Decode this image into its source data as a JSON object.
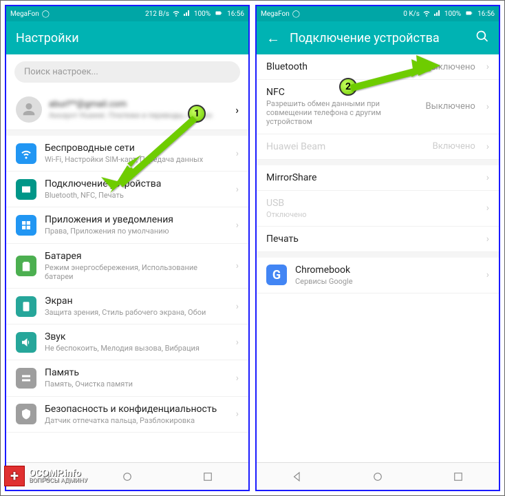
{
  "statusbar": {
    "carrier": "MegaFon",
    "speed_left": "212 B/s",
    "speed_right": "0 K/s",
    "battery": "100%",
    "time": "16:56"
  },
  "left": {
    "title": "Настройки",
    "search_placeholder": "Поиск настроек...",
    "profile": {
      "line1": "aburl**@gmail.com",
      "line2": "Аккаунт Huawei. Платежи и переводы, облако"
    },
    "items": [
      {
        "icon": "wifi",
        "color": "ic-blue",
        "title": "Беспроводные сети",
        "sub": "Wi-Fi, Настройки SIM-карт, Передача данных"
      },
      {
        "icon": "device",
        "color": "ic-teal",
        "title": "Подключение устройства",
        "sub": "Bluetooth, NFC, Печать"
      },
      {
        "icon": "apps",
        "color": "ic-blue",
        "title": "Приложения и уведомления",
        "sub": "Права, Приложения по умолчанию"
      },
      {
        "icon": "battery",
        "color": "ic-green",
        "title": "Батарея",
        "sub": "Режим энергосбережения, Использование батареи"
      },
      {
        "icon": "display",
        "color": "ic-tealg",
        "title": "Экран",
        "sub": "Защита зрения, Стиль рабочего экрана, Обои"
      },
      {
        "icon": "sound",
        "color": "ic-tealg",
        "title": "Звук",
        "sub": "Не беспокоить, Мелодия вызова, Вибрация"
      },
      {
        "icon": "storage",
        "color": "ic-grey",
        "title": "Память",
        "sub": "Память, Очистка памяти"
      },
      {
        "icon": "security",
        "color": "ic-grey",
        "title": "Безопасность и конфиденциальность",
        "sub": "Датчик отпечатка пальца, Разблокировка"
      }
    ]
  },
  "right": {
    "title": "Подключение устройства",
    "items": [
      {
        "title": "Bluetooth",
        "value": "Выключено"
      },
      {
        "title": "NFC",
        "sub": "Разрешить обмен данными при совмещении телефона с другим устройством",
        "value": "Выключено"
      },
      {
        "title": "Huawei Beam",
        "value": "Включено",
        "disabled": true
      },
      {
        "title": "MirrorShare"
      },
      {
        "title": "USB",
        "sub": "Отключено",
        "disabled": true
      },
      {
        "title": "Печать"
      },
      {
        "icon": "google",
        "title": "Chromebook",
        "sub": "Сервисы Google"
      }
    ]
  },
  "annotations": {
    "step1": "1",
    "step2": "2"
  },
  "watermark": {
    "line1": "OCOMP.info",
    "line2": "ВОПРОСЫ АДМИНУ"
  }
}
